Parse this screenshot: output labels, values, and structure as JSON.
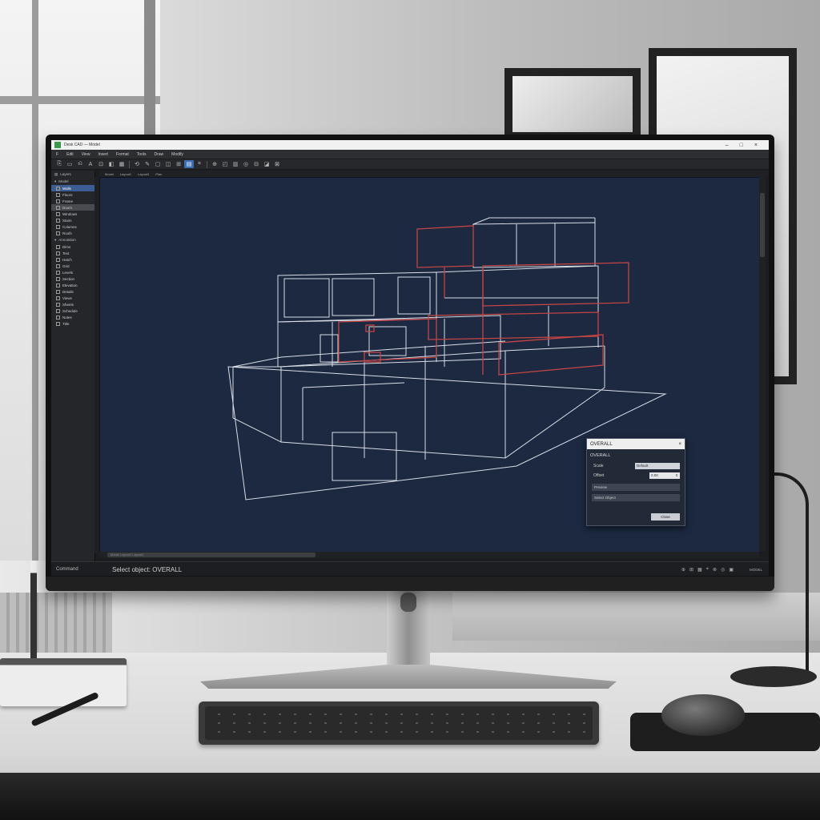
{
  "app": {
    "title": "Desk CAD — Model",
    "window_controls": [
      "–",
      "□",
      "×"
    ]
  },
  "menu": [
    "F",
    "Edit",
    "View",
    "Insert",
    "Format",
    "Tools",
    "Draw",
    "Modify"
  ],
  "toolbar": {
    "buttons": [
      "⎘",
      "▭",
      "⎌",
      "A",
      "⊡",
      "◧",
      "▦",
      "⟲",
      "✎",
      "▢",
      "◫",
      "⊞",
      "▤",
      "⌗",
      "⊕",
      "◰",
      "▥",
      "◎",
      "⊟",
      "◪",
      "⊠"
    ],
    "active_index": 12
  },
  "tabs": [
    "Model",
    "Layout1",
    "Layout2",
    "Plan"
  ],
  "palette": {
    "header": "Layers",
    "groups": [
      {
        "label": "Model",
        "items": [
          "Walls",
          "Floors",
          "Frame",
          "Doors",
          "Windows",
          "Stairs",
          "Columns",
          "Roofs"
        ]
      },
      {
        "label": "Annotation",
        "items": [
          "Dims",
          "Text",
          "Hatch",
          "Grid",
          "Levels",
          "Section",
          "Elevation",
          "Details",
          "Views",
          "Sheets",
          "Schedule",
          "Notes",
          "Title"
        ]
      }
    ]
  },
  "viewport": {
    "background": "#1c2940",
    "wire_color": "#d9dde6",
    "highlight_color": "#c44545"
  },
  "hscroll_label": "Model  Layout1  Layout2",
  "dialog": {
    "title": "OVERALL",
    "subtitle": "OVERALL",
    "rows": [
      {
        "label": "Scale",
        "value": "Default"
      },
      {
        "label": "Offset",
        "value": "0.00"
      }
    ],
    "bars": [
      "Preview",
      "Select Object"
    ],
    "ok": "Close",
    "close_icon": "×"
  },
  "command": {
    "prefix": "Command",
    "text": "Select object: OVERALL"
  },
  "status": {
    "icons": [
      "⊕",
      "⊞",
      "▦",
      "⌖",
      "⊗",
      "◎",
      "▣"
    ],
    "mode": "MODEL"
  }
}
